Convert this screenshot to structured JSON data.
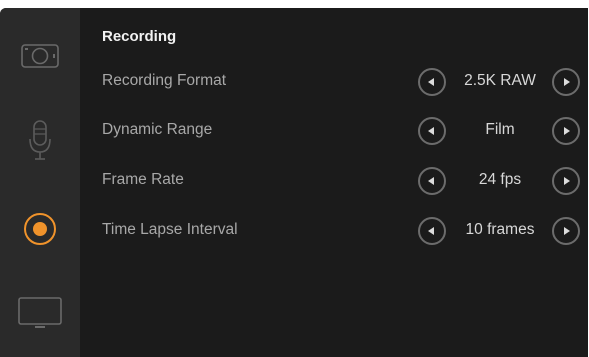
{
  "sidebar": {
    "items": [
      {
        "icon": "camera-icon",
        "active": false
      },
      {
        "icon": "microphone-icon",
        "active": false
      },
      {
        "icon": "record-icon",
        "active": true
      },
      {
        "icon": "monitor-icon",
        "active": false
      }
    ],
    "accent_color": "#f0932b"
  },
  "page": {
    "title": "Recording"
  },
  "settings": [
    {
      "label": "Recording Format",
      "value": "2.5K RAW"
    },
    {
      "label": "Dynamic Range",
      "value": "Film"
    },
    {
      "label": "Frame Rate",
      "value": "24 fps"
    },
    {
      "label": "Time Lapse Interval",
      "value": "10 frames"
    }
  ]
}
